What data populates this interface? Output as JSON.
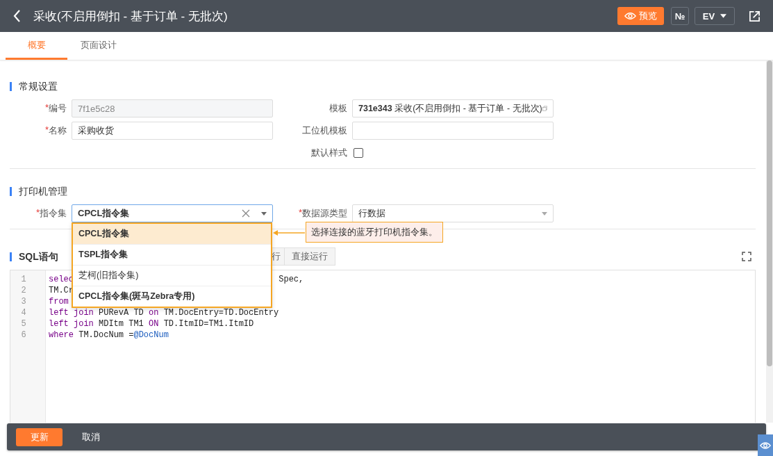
{
  "header": {
    "title": "采收(不启用倒扣 - 基于订单 - 无批次)",
    "preview_button": "预览",
    "number_button": "№",
    "language_button": "EV"
  },
  "tabs": [
    {
      "label": "概要",
      "selected": true
    },
    {
      "label": "页面设计",
      "selected": false
    }
  ],
  "general": {
    "title": "常规设置",
    "left_fields": [
      {
        "label": "编号",
        "required_mark": "*",
        "value": "7f1e5c28",
        "disabled": true
      },
      {
        "label": "名称",
        "required_mark": "*",
        "value": "采购收货",
        "disabled": false
      }
    ],
    "template": {
      "label": "模板",
      "code": "731e343",
      "name": "采收(不启用倒扣 - 基于订单 - 无批次)"
    },
    "station_template": {
      "label": "工位机模板"
    },
    "default_style": {
      "label": "默认样式",
      "checked": false
    }
  },
  "printer": {
    "title": "打印机管理",
    "command_set": {
      "label": "指令集",
      "required_mark": "*",
      "value": "CPCL指令集"
    },
    "data_source": {
      "label": "数据源类型",
      "required_mark": "*",
      "value": "行数据"
    },
    "dropdown": [
      {
        "label": "CPCL指令集",
        "selected": true
      },
      {
        "label": "TSPL指令集",
        "selected": false
      },
      {
        "label": "芝柯(旧指令集)",
        "selected": false
      },
      {
        "label": "CPCL指令集(斑马Zebra专用)",
        "selected": false
      }
    ],
    "tooltip": "选择连接的蓝牙打印机指令集。"
  },
  "sql": {
    "title": "SQL语句",
    "buttons": [
      "行",
      "直接运行"
    ],
    "lines": [
      {
        "number": "1",
        "segments": [
          [
            {
              "kind": "keyword",
              "text": "selec"
            }
          ],
          [
            {
              "kind": "plain",
              "text": "Spec,"
            }
          ]
        ]
      },
      {
        "number": "2",
        "segments": [
          [
            {
              "kind": "plain",
              "text": "TM.Cr"
            }
          ]
        ]
      },
      {
        "number": "3",
        "segments": [
          [
            {
              "kind": "keyword",
              "text": "from"
            }
          ]
        ]
      },
      {
        "number": "4",
        "segments": [
          [
            {
              "kind": "keyword",
              "text": "left join"
            },
            {
              "kind": "plain",
              "text": " PURevA TD "
            },
            {
              "kind": "keyword",
              "text": "on"
            },
            {
              "kind": "plain",
              "text": " TM.DocEntry=TD.DocEntry"
            }
          ]
        ]
      },
      {
        "number": "5",
        "segments": [
          [
            {
              "kind": "keyword",
              "text": "left join"
            },
            {
              "kind": "plain",
              "text": " MDItm TM1 "
            },
            {
              "kind": "keyword",
              "text": "ON"
            },
            {
              "kind": "plain",
              "text": " TD.ItmID=TM1.ItmID"
            }
          ]
        ]
      },
      {
        "number": "6",
        "segments": [
          [
            {
              "kind": "keyword",
              "text": "where"
            },
            {
              "kind": "plain",
              "text": " TM.DocNum ="
            },
            {
              "kind": "variable",
              "text": "@DocNum"
            }
          ]
        ]
      }
    ]
  },
  "footer": {
    "update_button": "更新",
    "cancel_button": "取消"
  }
}
